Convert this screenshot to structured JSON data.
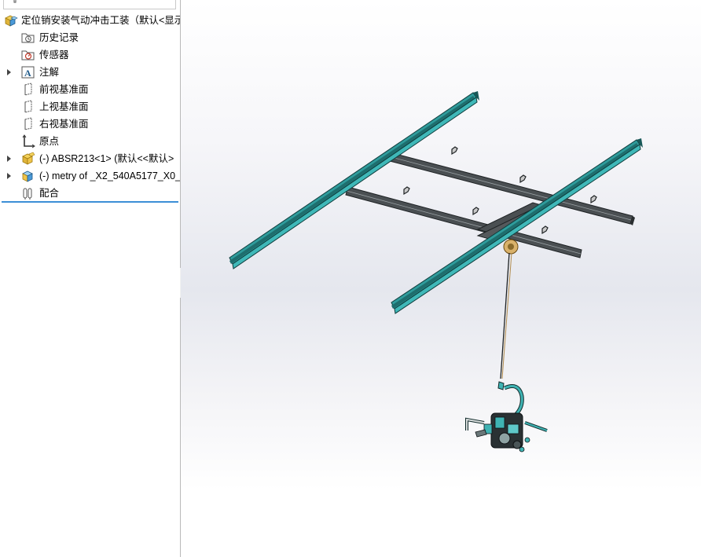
{
  "feature_tree": {
    "root": {
      "label": "定位销安装气动冲击工装（默认<显示",
      "icon": "assembly-icon"
    },
    "items": [
      {
        "label": "历史记录",
        "icon": "history-folder-icon",
        "expandable": false
      },
      {
        "label": "传感器",
        "icon": "sensor-folder-icon",
        "expandable": false
      },
      {
        "label": "注解",
        "icon": "annotation-icon",
        "expandable": true
      },
      {
        "label": "前视基准面",
        "icon": "plane-icon",
        "expandable": false
      },
      {
        "label": "上视基准面",
        "icon": "plane-icon",
        "expandable": false
      },
      {
        "label": "右视基准面",
        "icon": "plane-icon",
        "expandable": false
      },
      {
        "label": "原点",
        "icon": "origin-icon",
        "expandable": false
      },
      {
        "label": "(-) ABSR213<1> (默认<<默认>",
        "icon": "subassembly-icon",
        "expandable": true
      },
      {
        "label": "(-) metry of _X2_540A5177_X0_",
        "icon": "part-icon",
        "expandable": true
      },
      {
        "label": "配合",
        "icon": "mates-icon",
        "expandable": false
      }
    ]
  },
  "colors": {
    "rail_teal": "#2f9c9c",
    "beam_dark": "#3b3f42",
    "selection_blue": "#3c8fd6",
    "tool_cyan": "#3fb3b3"
  },
  "viewport": {
    "model": "pneumatic impact tool on overhead crane rail system",
    "icons": [
      "filter-icon",
      "collapse-handle-icon"
    ]
  }
}
